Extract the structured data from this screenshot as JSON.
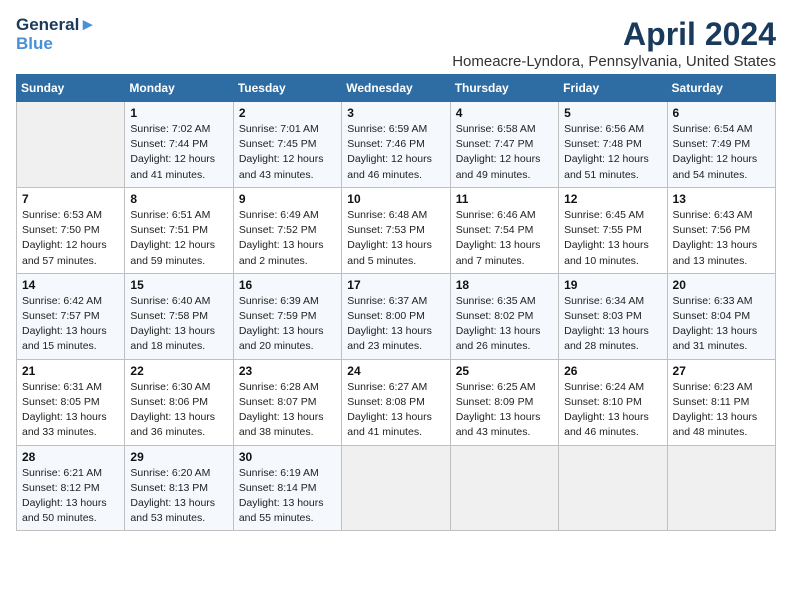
{
  "header": {
    "logo_line1": "General",
    "logo_line2": "Blue",
    "month_year": "April 2024",
    "location": "Homeacre-Lyndora, Pennsylvania, United States"
  },
  "days_of_week": [
    "Sunday",
    "Monday",
    "Tuesday",
    "Wednesday",
    "Thursday",
    "Friday",
    "Saturday"
  ],
  "weeks": [
    [
      {
        "day": "",
        "sunrise": "",
        "sunset": "",
        "daylight": ""
      },
      {
        "day": "1",
        "sunrise": "Sunrise: 7:02 AM",
        "sunset": "Sunset: 7:44 PM",
        "daylight": "Daylight: 12 hours and 41 minutes."
      },
      {
        "day": "2",
        "sunrise": "Sunrise: 7:01 AM",
        "sunset": "Sunset: 7:45 PM",
        "daylight": "Daylight: 12 hours and 43 minutes."
      },
      {
        "day": "3",
        "sunrise": "Sunrise: 6:59 AM",
        "sunset": "Sunset: 7:46 PM",
        "daylight": "Daylight: 12 hours and 46 minutes."
      },
      {
        "day": "4",
        "sunrise": "Sunrise: 6:58 AM",
        "sunset": "Sunset: 7:47 PM",
        "daylight": "Daylight: 12 hours and 49 minutes."
      },
      {
        "day": "5",
        "sunrise": "Sunrise: 6:56 AM",
        "sunset": "Sunset: 7:48 PM",
        "daylight": "Daylight: 12 hours and 51 minutes."
      },
      {
        "day": "6",
        "sunrise": "Sunrise: 6:54 AM",
        "sunset": "Sunset: 7:49 PM",
        "daylight": "Daylight: 12 hours and 54 minutes."
      }
    ],
    [
      {
        "day": "7",
        "sunrise": "Sunrise: 6:53 AM",
        "sunset": "Sunset: 7:50 PM",
        "daylight": "Daylight: 12 hours and 57 minutes."
      },
      {
        "day": "8",
        "sunrise": "Sunrise: 6:51 AM",
        "sunset": "Sunset: 7:51 PM",
        "daylight": "Daylight: 12 hours and 59 minutes."
      },
      {
        "day": "9",
        "sunrise": "Sunrise: 6:49 AM",
        "sunset": "Sunset: 7:52 PM",
        "daylight": "Daylight: 13 hours and 2 minutes."
      },
      {
        "day": "10",
        "sunrise": "Sunrise: 6:48 AM",
        "sunset": "Sunset: 7:53 PM",
        "daylight": "Daylight: 13 hours and 5 minutes."
      },
      {
        "day": "11",
        "sunrise": "Sunrise: 6:46 AM",
        "sunset": "Sunset: 7:54 PM",
        "daylight": "Daylight: 13 hours and 7 minutes."
      },
      {
        "day": "12",
        "sunrise": "Sunrise: 6:45 AM",
        "sunset": "Sunset: 7:55 PM",
        "daylight": "Daylight: 13 hours and 10 minutes."
      },
      {
        "day": "13",
        "sunrise": "Sunrise: 6:43 AM",
        "sunset": "Sunset: 7:56 PM",
        "daylight": "Daylight: 13 hours and 13 minutes."
      }
    ],
    [
      {
        "day": "14",
        "sunrise": "Sunrise: 6:42 AM",
        "sunset": "Sunset: 7:57 PM",
        "daylight": "Daylight: 13 hours and 15 minutes."
      },
      {
        "day": "15",
        "sunrise": "Sunrise: 6:40 AM",
        "sunset": "Sunset: 7:58 PM",
        "daylight": "Daylight: 13 hours and 18 minutes."
      },
      {
        "day": "16",
        "sunrise": "Sunrise: 6:39 AM",
        "sunset": "Sunset: 7:59 PM",
        "daylight": "Daylight: 13 hours and 20 minutes."
      },
      {
        "day": "17",
        "sunrise": "Sunrise: 6:37 AM",
        "sunset": "Sunset: 8:00 PM",
        "daylight": "Daylight: 13 hours and 23 minutes."
      },
      {
        "day": "18",
        "sunrise": "Sunrise: 6:35 AM",
        "sunset": "Sunset: 8:02 PM",
        "daylight": "Daylight: 13 hours and 26 minutes."
      },
      {
        "day": "19",
        "sunrise": "Sunrise: 6:34 AM",
        "sunset": "Sunset: 8:03 PM",
        "daylight": "Daylight: 13 hours and 28 minutes."
      },
      {
        "day": "20",
        "sunrise": "Sunrise: 6:33 AM",
        "sunset": "Sunset: 8:04 PM",
        "daylight": "Daylight: 13 hours and 31 minutes."
      }
    ],
    [
      {
        "day": "21",
        "sunrise": "Sunrise: 6:31 AM",
        "sunset": "Sunset: 8:05 PM",
        "daylight": "Daylight: 13 hours and 33 minutes."
      },
      {
        "day": "22",
        "sunrise": "Sunrise: 6:30 AM",
        "sunset": "Sunset: 8:06 PM",
        "daylight": "Daylight: 13 hours and 36 minutes."
      },
      {
        "day": "23",
        "sunrise": "Sunrise: 6:28 AM",
        "sunset": "Sunset: 8:07 PM",
        "daylight": "Daylight: 13 hours and 38 minutes."
      },
      {
        "day": "24",
        "sunrise": "Sunrise: 6:27 AM",
        "sunset": "Sunset: 8:08 PM",
        "daylight": "Daylight: 13 hours and 41 minutes."
      },
      {
        "day": "25",
        "sunrise": "Sunrise: 6:25 AM",
        "sunset": "Sunset: 8:09 PM",
        "daylight": "Daylight: 13 hours and 43 minutes."
      },
      {
        "day": "26",
        "sunrise": "Sunrise: 6:24 AM",
        "sunset": "Sunset: 8:10 PM",
        "daylight": "Daylight: 13 hours and 46 minutes."
      },
      {
        "day": "27",
        "sunrise": "Sunrise: 6:23 AM",
        "sunset": "Sunset: 8:11 PM",
        "daylight": "Daylight: 13 hours and 48 minutes."
      }
    ],
    [
      {
        "day": "28",
        "sunrise": "Sunrise: 6:21 AM",
        "sunset": "Sunset: 8:12 PM",
        "daylight": "Daylight: 13 hours and 50 minutes."
      },
      {
        "day": "29",
        "sunrise": "Sunrise: 6:20 AM",
        "sunset": "Sunset: 8:13 PM",
        "daylight": "Daylight: 13 hours and 53 minutes."
      },
      {
        "day": "30",
        "sunrise": "Sunrise: 6:19 AM",
        "sunset": "Sunset: 8:14 PM",
        "daylight": "Daylight: 13 hours and 55 minutes."
      },
      {
        "day": "",
        "sunrise": "",
        "sunset": "",
        "daylight": ""
      },
      {
        "day": "",
        "sunrise": "",
        "sunset": "",
        "daylight": ""
      },
      {
        "day": "",
        "sunrise": "",
        "sunset": "",
        "daylight": ""
      },
      {
        "day": "",
        "sunrise": "",
        "sunset": "",
        "daylight": ""
      }
    ]
  ]
}
